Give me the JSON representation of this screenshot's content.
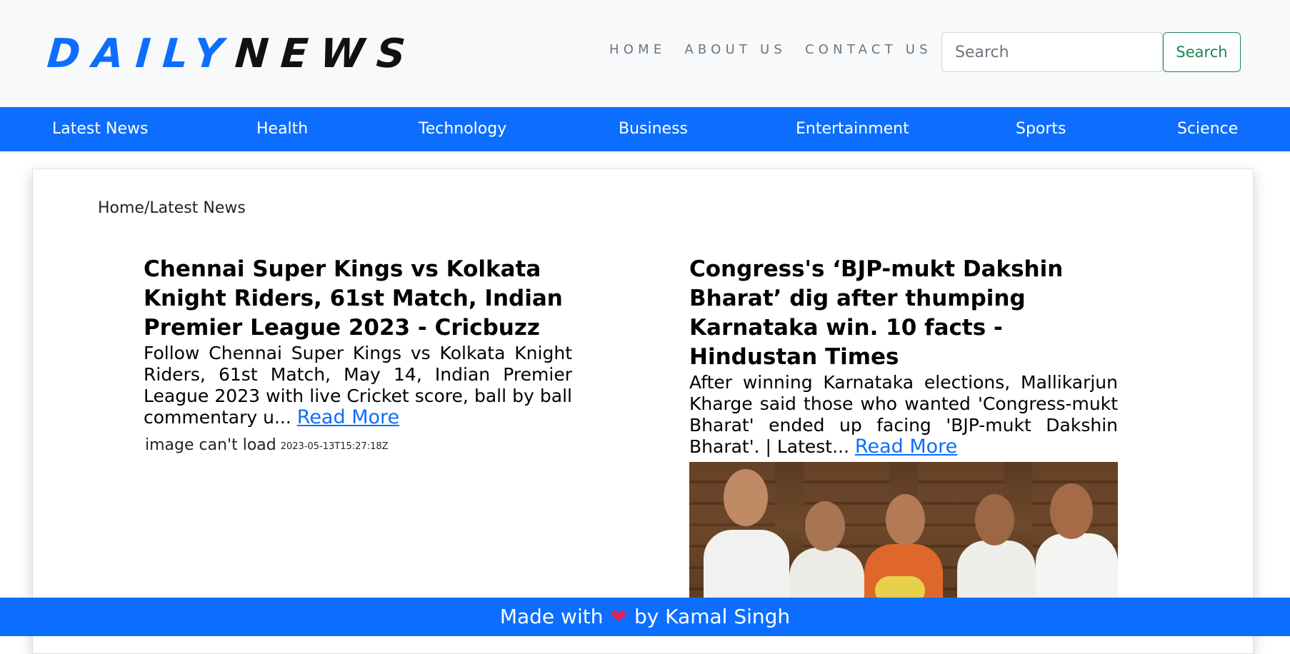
{
  "brand": {
    "part1": "DAILY",
    "part2": "NEWS"
  },
  "top_nav": {
    "items": [
      "HOME",
      "ABOUT US",
      "CONTACT US"
    ]
  },
  "search": {
    "placeholder": "Search",
    "button_label": "Search"
  },
  "categories": [
    "Latest News",
    "Health",
    "Technology",
    "Business",
    "Entertainment",
    "Sports",
    "Science"
  ],
  "breadcrumb": "Home/Latest News",
  "articles": [
    {
      "title": "Chennai Super Kings vs Kolkata Knight Riders, 61st Match, Indian Premier League 2023 - Cricbuzz",
      "description": "Follow Chennai Super Kings vs Kolkata Knight Riders, 61st Match, May 14, Indian Premier League 2023 with live Cricket score, ball by ball commentary u...",
      "read_more": "Read More",
      "image_alt": "image can't load",
      "published_at": "2023-05-13T15:27:18Z"
    },
    {
      "title": "Congress's ‘BJP-mukt Dakshin Bharat’ dig after thumping Karnataka win. 10 facts - Hindustan Times",
      "description": "After winning Karnataka elections, Mallikarjun Kharge said those who wanted 'Congress-mukt Bharat' ended up facing 'BJP-mukt Dakshin Bharat'. | Latest...",
      "read_more": "Read More"
    }
  ],
  "footer": {
    "made_with": "Made with",
    "heart": "❤",
    "by": "by Kamal Singh"
  },
  "colors": {
    "primary": "#0d6efd",
    "success": "#198754",
    "header_bg": "#f8f9fa"
  }
}
